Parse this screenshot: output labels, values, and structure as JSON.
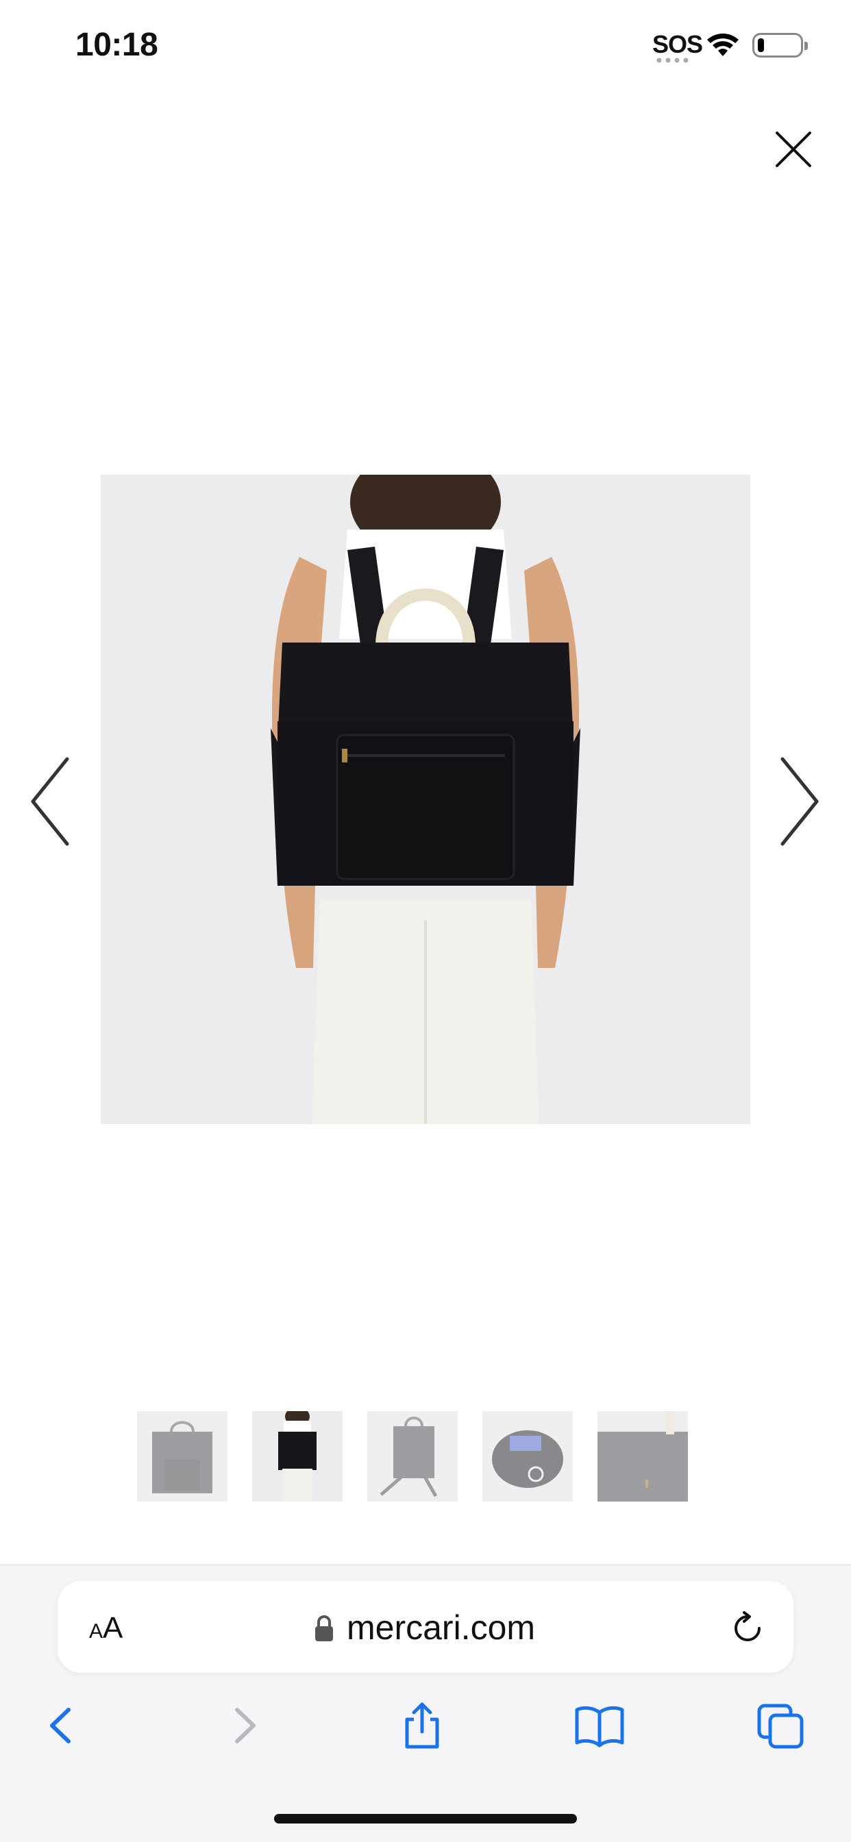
{
  "status_bar": {
    "time": "10:18",
    "sos": "SOS",
    "battery_level": 0.15
  },
  "viewer": {
    "close_icon": "close-icon",
    "prev_icon": "chevron-left-icon",
    "next_icon": "chevron-right-icon",
    "main_image_alt": "product-photo-black-backpack-worn",
    "selected_thumbnail_index": 1,
    "thumbnail_count": 5
  },
  "browser": {
    "text_size_label_small": "A",
    "text_size_label_large": "A",
    "url": "mercari.com",
    "reload_icon": "reload-icon",
    "toolbar": [
      {
        "name": "back-icon",
        "enabled": true
      },
      {
        "name": "forward-icon",
        "enabled": false
      },
      {
        "name": "share-icon",
        "enabled": true
      },
      {
        "name": "bookmarks-icon",
        "enabled": true
      },
      {
        "name": "tabs-icon",
        "enabled": true
      }
    ]
  },
  "colors": {
    "accent": "#1a73e8",
    "bag": "#16161a",
    "disabled": "#b8b8bd"
  }
}
